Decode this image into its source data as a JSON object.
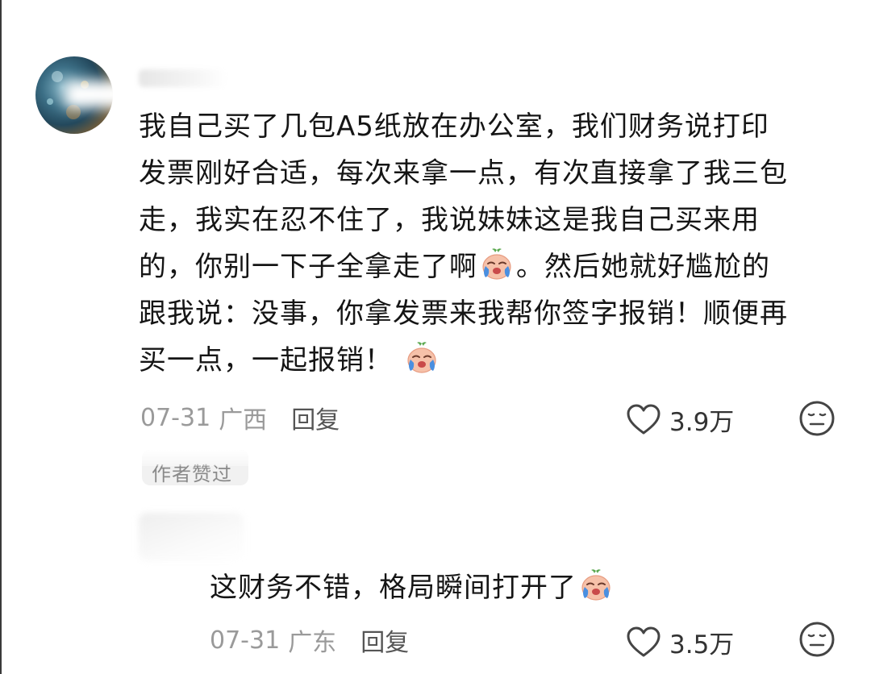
{
  "comment": {
    "lines": [
      "我自己买了几包A5纸放在办公室，我们财务说打印",
      "发票刚好合适，每次来拿一点，有次直接拿了我三包",
      "走，我实在忍不住了，我说妹妹这是我自己买来用",
      "的，你别一下子全拿走了啊",
      "。然后她就好尴尬的",
      "跟我说：没事，你拿发票来我帮你签字报销！顺便再",
      "买一点，一起报销！"
    ],
    "emoji_icon": "crying-emoji-icon",
    "date": "07-31",
    "location": "广西",
    "reply_label": "回复",
    "like_count": "3.9万"
  },
  "author_liked_badge": "作者赞过",
  "reply": {
    "text": "这财务不错，格局瞬间打开了",
    "emoji_icon": "crying-emoji-icon",
    "date": "07-31",
    "location": "广东",
    "reply_label": "回复",
    "like_count": "3.5万"
  },
  "colors": {
    "text": "#151515",
    "meta": "#9a9a9a",
    "reply_label": "#555555",
    "emoji_face": "#f6c1a9",
    "emoji_tear": "#4a8fe0"
  }
}
